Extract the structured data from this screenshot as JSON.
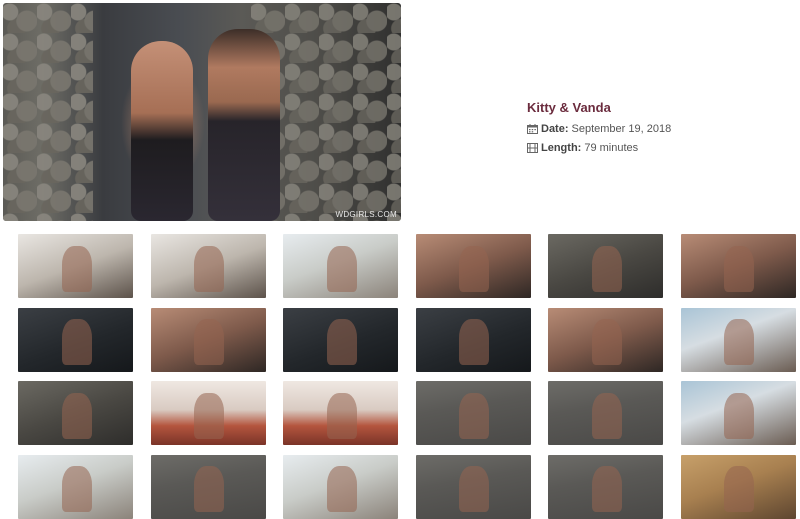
{
  "scene": {
    "title": "Kitty & Vanda",
    "watermark": "WDGIRLS.COM",
    "date_label": "Date:",
    "date_value": "September 19, 2018",
    "length_label": "Length:",
    "length_value": "79 minutes",
    "accent_color": "#6b2c3e"
  },
  "icons": {
    "date": "calendar-icon",
    "length": "film-icon"
  },
  "gallery": {
    "thumbnails": [
      {
        "tone": "t-room"
      },
      {
        "tone": "t-room"
      },
      {
        "tone": "t-bright"
      },
      {
        "tone": "t-face"
      },
      {
        "tone": "t-stone"
      },
      {
        "tone": "t-face"
      },
      {
        "tone": "t-dark"
      },
      {
        "tone": "t-face"
      },
      {
        "tone": "t-dark"
      },
      {
        "tone": "t-dark"
      },
      {
        "tone": "t-face"
      },
      {
        "tone": "t-window"
      },
      {
        "tone": "t-stone"
      },
      {
        "tone": "t-sofa"
      },
      {
        "tone": "t-sofa"
      },
      {
        "tone": "t-deck"
      },
      {
        "tone": "t-deck"
      },
      {
        "tone": "t-window"
      },
      {
        "tone": "t-bright"
      },
      {
        "tone": "t-deck"
      },
      {
        "tone": "t-bright"
      },
      {
        "tone": "t-deck"
      },
      {
        "tone": "t-deck"
      },
      {
        "tone": "t-hall"
      }
    ]
  }
}
